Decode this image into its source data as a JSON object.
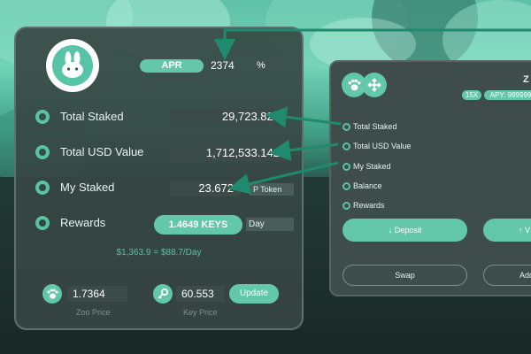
{
  "colors": {
    "accent": "#63c7aa",
    "panel": "#374643",
    "field": "#3a4b48",
    "caption": "#7e918d"
  },
  "header": {
    "logo_icon": "bunny-icon",
    "apr_label": "APR",
    "apr_value": "2374",
    "apr_unit": "%"
  },
  "stats": {
    "total_staked": {
      "label": "Total Staked",
      "value": "29,723.828"
    },
    "total_usd_value": {
      "label": "Total USD Value",
      "value": "1,712,533.142"
    },
    "my_staked": {
      "label": "My Staked",
      "value": "23.672",
      "token_tag": "P Token"
    },
    "rewards": {
      "label": "Rewards",
      "value": "1.4649 KEYS",
      "period": "Day",
      "summary": "$1,363.9 = $88.7/Day"
    }
  },
  "prices": {
    "zoo": {
      "icon": "paw-icon",
      "value": "1.7364",
      "caption": "Zoo Price"
    },
    "key": {
      "icon": "key-icon",
      "value": "60.553",
      "caption": "Key Price"
    },
    "update_label": "Update"
  },
  "pool_card": {
    "title": "Z",
    "icons": [
      "paw-icon",
      "binance-icon"
    ],
    "multiplier": "15X",
    "apy": "APY: 999999",
    "rows": [
      "Total Staked",
      "Total USD Value",
      "My Staked",
      "Balance",
      "Rewards"
    ],
    "deposit_label": "↓ Deposit",
    "withdraw_label": "↑ V",
    "swap_label": "Swap",
    "add_label": "Add"
  }
}
